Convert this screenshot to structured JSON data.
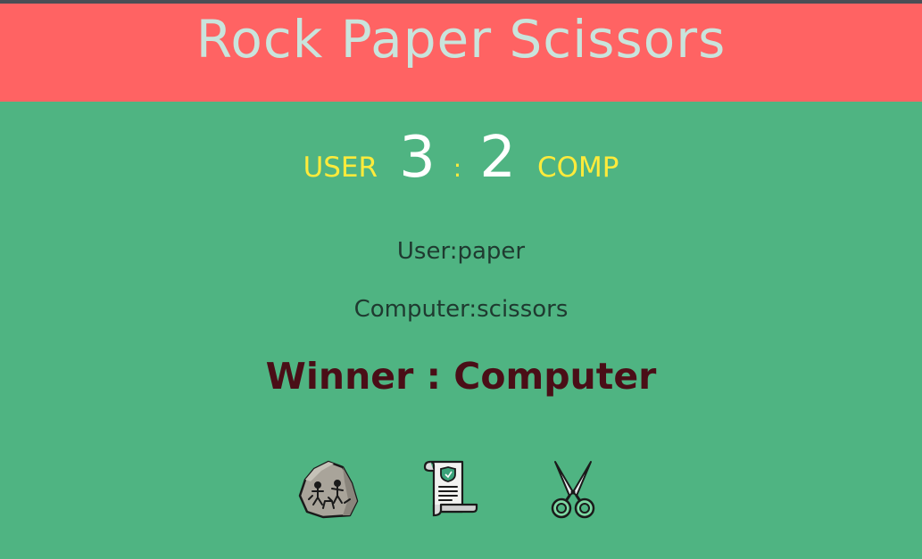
{
  "header": {
    "title": "Rock Paper Scissors"
  },
  "scoreboard": {
    "user_label": "USER",
    "user_score": "3",
    "separator": ":",
    "comp_score": "2",
    "comp_label": "COMP"
  },
  "result": {
    "user_choice": "User:paper",
    "computer_choice": "Computer:scissors",
    "winner": "Winner : Computer"
  },
  "options": [
    {
      "name": "rock",
      "icon": "rock-icon"
    },
    {
      "name": "paper",
      "icon": "paper-scroll-icon"
    },
    {
      "name": "scissors",
      "icon": "scissors-icon"
    }
  ],
  "colors": {
    "background": "#4fb482",
    "header": "#ff6363",
    "title": "#c9e4dc",
    "score_label": "#ffeb3b",
    "score_number": "#ffffff",
    "winner_text": "#4a0e17"
  }
}
